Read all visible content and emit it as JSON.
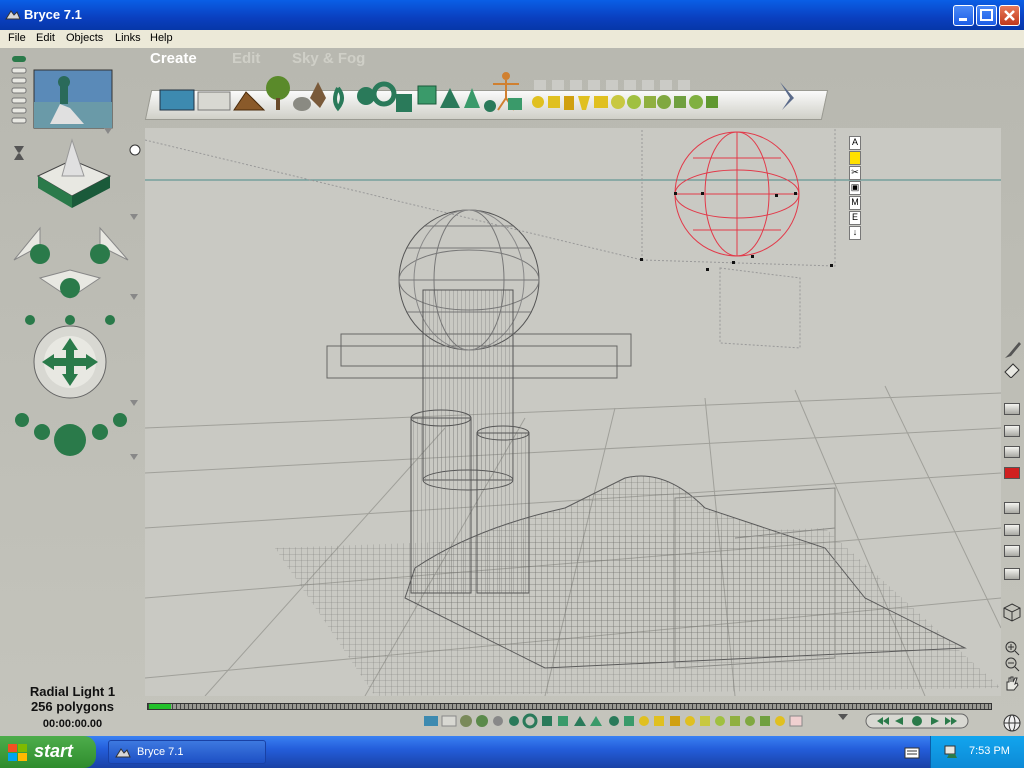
{
  "window": {
    "title": "Bryce 7.1"
  },
  "menu": [
    "File",
    "Edit",
    "Objects",
    "Links",
    "Help"
  ],
  "modes": [
    "Create",
    "Edit",
    "Sky & Fog"
  ],
  "viewport_labels": [
    "A",
    "■",
    "✂",
    "▣",
    "M",
    "E",
    "↓"
  ],
  "status": {
    "selection": "Radial Light 1",
    "polygons": "256 polygons",
    "timecode": "00:00:00.00"
  },
  "taskbar": {
    "start_label": "start",
    "task_label": "Bryce 7.1",
    "clock": "7:53 PM"
  },
  "colors": {
    "selection_wire": "#e23a4a",
    "mesh_wire": "#5a5a5a",
    "xp_blue": "#245edb",
    "xp_green": "#2f8c2d"
  },
  "icons": {
    "left_panel": [
      "preview-thumbnail",
      "nano-preview-icon",
      "view-control-icon",
      "camera-trackball-icon",
      "render-ball-icon"
    ],
    "create_shelf": [
      "water-plane-icon",
      "ground-plane-icon",
      "terrain-icon",
      "tree-icon",
      "rock-icon",
      "stone-icon",
      "torus-icon",
      "cylinder-icon",
      "cube-icon",
      "cone-icon",
      "human-figure-icon",
      "primitive-icon"
    ]
  }
}
